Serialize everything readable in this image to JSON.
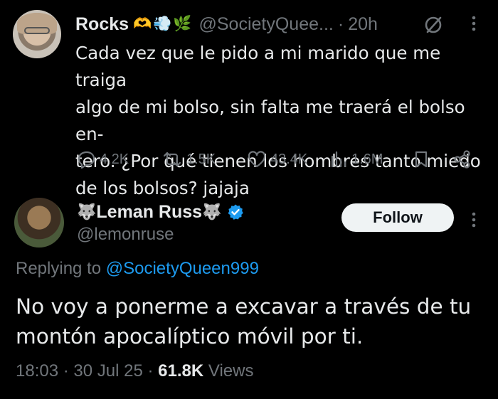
{
  "tweet1": {
    "display_name": "Rocks",
    "name_emoji": "🫶💨🌿",
    "handle": "@SocietyQuee...",
    "separator": "·",
    "time": "20h",
    "grok_icon": "grok-icon",
    "more_icon": "more-vertical-icon",
    "text": "Cada vez que le pido a mi marido que me traiga\nalgo de mi bolso, sin falta me traerá el bolso en-\ntero. ¿Por qué tienen los hombres tanto miedo\nde los bolsos? jajaja",
    "actions": {
      "replies": "4.2K",
      "reposts": "1.5K",
      "likes": "43.4K",
      "views": "1.6M"
    }
  },
  "tweet2": {
    "name_emoji_left": "🐺",
    "display_name": "Leman Russ",
    "name_emoji_right": "🐺",
    "handle": "@lemonruse",
    "follow_label": "Follow",
    "more_icon": "more-vertical-icon",
    "replying_prefix": "Replying to",
    "replying_to": "@SocietyQueen999",
    "text": "No voy a ponerme a excavar a través de tu\nmontón apocalíptico móvil por ti.",
    "time": "18:03",
    "date": "30 Jul 25",
    "separator": "·",
    "views_count": "61.8K",
    "views_label": "Views"
  },
  "colors": {
    "background": "#000000",
    "text": "#e7e9ea",
    "muted": "#71767b",
    "accent": "#1d9bf0"
  }
}
